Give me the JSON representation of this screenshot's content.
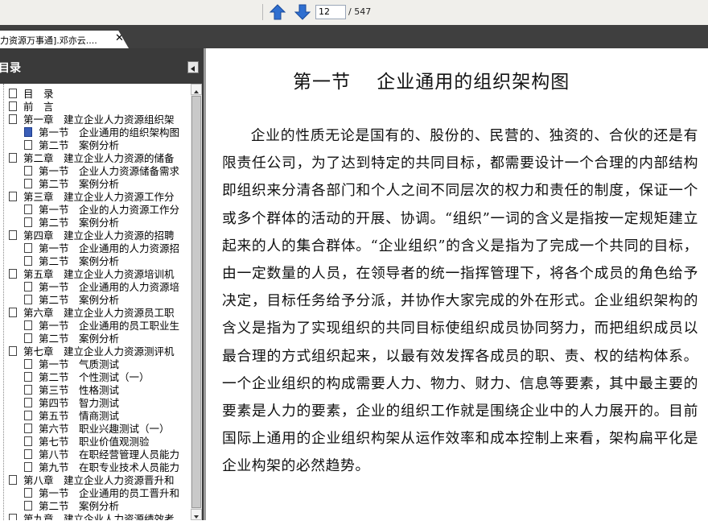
{
  "toolbar": {
    "prev_icon": "arrow-up-icon",
    "next_icon": "arrow-down-icon",
    "page_current": "12",
    "page_total": "/ 547"
  },
  "tab": {
    "title": "力资源万事通].邓亦云....",
    "close": "✕"
  },
  "sidebar": {
    "title": "目录",
    "collapse_icon": "triangle-left-icon",
    "items": [
      {
        "label": "目　录",
        "level": 0
      },
      {
        "label": "前　言",
        "level": 0
      },
      {
        "label": "第一章　建立企业人力资源组织架",
        "level": 0
      },
      {
        "label": "第一节　企业通用的组织架构图",
        "level": 1,
        "active": true
      },
      {
        "label": "第二节　案例分析",
        "level": 1
      },
      {
        "label": "第二章　建立企业人力资源的储备",
        "level": 0
      },
      {
        "label": "第一节　企业人力资源储备需求",
        "level": 1
      },
      {
        "label": "第二节　案例分析",
        "level": 1
      },
      {
        "label": "第三章　建立企业人力资源工作分",
        "level": 0
      },
      {
        "label": "第一节　企业的人力资源工作分",
        "level": 1
      },
      {
        "label": "第二节　案例分析",
        "level": 1
      },
      {
        "label": "第四章　建立企业人力资源的招聘",
        "level": 0
      },
      {
        "label": "第一节　企业通用的人力资源招",
        "level": 1
      },
      {
        "label": "第二节　案例分析",
        "level": 1
      },
      {
        "label": "第五章　建立企业人力资源培训机",
        "level": 0
      },
      {
        "label": "第一节　企业通用的人力资源培",
        "level": 1
      },
      {
        "label": "第二节　案例分析",
        "level": 1
      },
      {
        "label": "第六章　建立企业人力资源员工职",
        "level": 0
      },
      {
        "label": "第一节　企业通用的员工职业生",
        "level": 1
      },
      {
        "label": "第二节　案例分析",
        "level": 1
      },
      {
        "label": "第七章　建立企业人力资源测评机",
        "level": 0
      },
      {
        "label": "第一节　气质测试",
        "level": 1
      },
      {
        "label": "第二节　个性测试（一）",
        "level": 1
      },
      {
        "label": "第三节　性格测试",
        "level": 1
      },
      {
        "label": "第四节　智力测试",
        "level": 1
      },
      {
        "label": "第五节　情商测试",
        "level": 1
      },
      {
        "label": "第六节　职业兴趣测试（一）",
        "level": 1
      },
      {
        "label": "第七节　职业价值观测验",
        "level": 1
      },
      {
        "label": "第八节　在职经营管理人员能力",
        "level": 1
      },
      {
        "label": "第九节　在职专业技术人员能力",
        "level": 1
      },
      {
        "label": "第八章　建立企业人力资源晋升和",
        "level": 0
      },
      {
        "label": "第一节　企业通用的员工晋升和",
        "level": 1
      },
      {
        "label": "第二节　案例分析",
        "level": 1
      },
      {
        "label": "第九章　建立企业人力资源绩效考",
        "level": 0
      }
    ]
  },
  "document": {
    "heading": "第一节　 企业通用的组织架构图",
    "paragraph": "企业的性质无论是国有的、股份的、民营的、独资的、合伙的还是有限责任公司，为了达到特定的共同目标，都需要设计一个合理的内部结构即组织来分清各部门和个人之间不同层次的权力和责任的制度，保证一个或多个群体的活动的开展、协调。“组织”一词的含义是指按一定规矩建立起来的人的集合群体。“企业组织”的含义是指为了完成一个共同的目标，由一定数量的人员，在领导者的统一指挥管理下，将各个成员的角色给予决定，目标任务给予分派，并协作大家完成的外在形式。企业组织架构的含义是指为了实现组织的共同目标使组织成员协同努力，而把组织成员以最合理的方式组织起来，以最有效发挥各成员的职、责、权的结构体系。一个企业组织的构成需要人力、物力、财力、信息等要素，其中最主要的要素是人力的要素，企业的组织工作就是围绕企业中的人力展开的。目前国际上通用的企业组织构架从运作效率和成本控制上来看，架构扁平化是企业构架的必然趋势。"
  },
  "colors": {
    "nav_arrow": "#2f6fd0",
    "panel_bg": "#3a3a3a",
    "tabbar_bg": "#3f3f3f"
  }
}
